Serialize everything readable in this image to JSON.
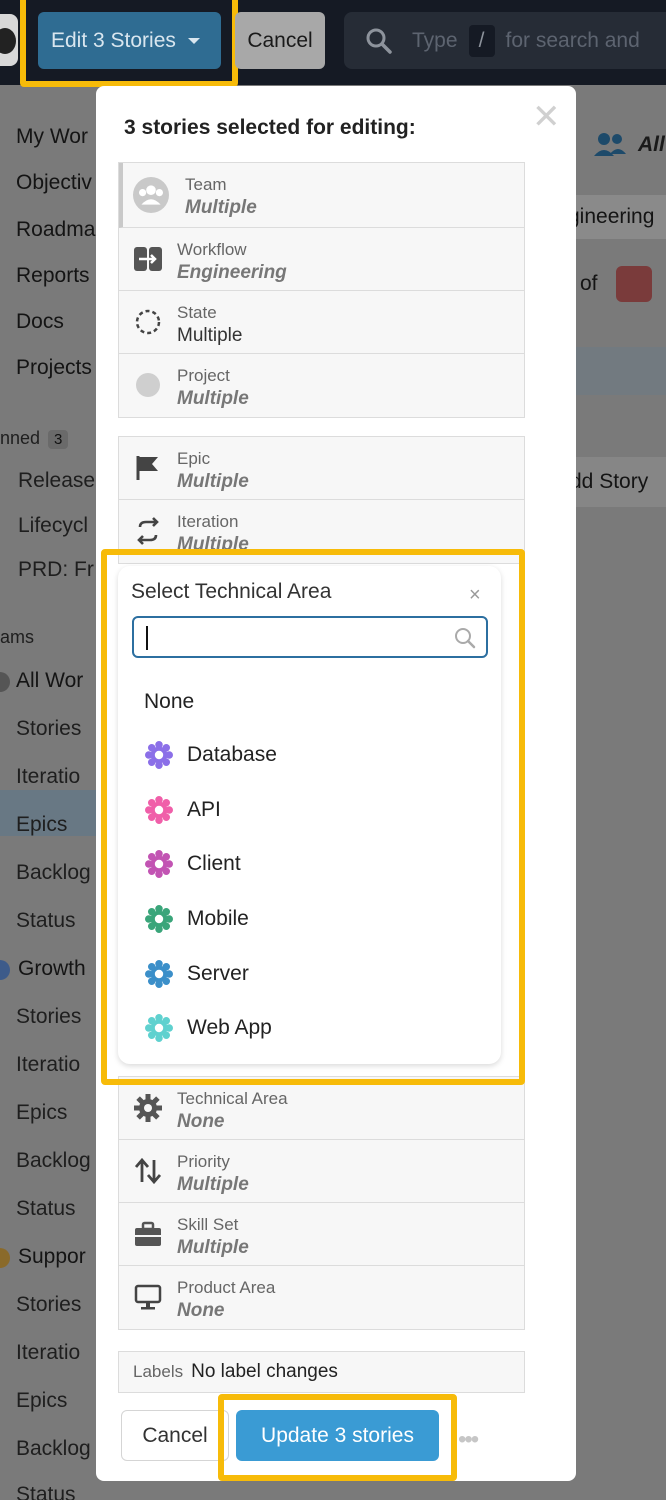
{
  "topbar": {
    "edit_button": "Edit 3 Stories",
    "cancel_button": "Cancel",
    "search_before_key": "Type",
    "search_key": "/",
    "search_after_key": "for search and"
  },
  "sidebar": {
    "nav": [
      "My Wor",
      "Objectiv",
      "Roadma",
      "Reports",
      "Docs",
      "Projects"
    ],
    "pinned_heading": "nned",
    "pinned_count": "3",
    "pinned": [
      "Release",
      "Lifecycl",
      "PRD: Fr"
    ],
    "teams_heading": "ams",
    "team_all": "All Wor",
    "team_all_items": [
      "Stories",
      "Iteratio",
      "Epics",
      "Backlog",
      "Status"
    ],
    "team_growth": "Growth",
    "team_growth_items": [
      "Stories",
      "Iteratio",
      "Epics",
      "Backlog",
      "Status"
    ],
    "team_support": "Suppor",
    "team_support_items": [
      "Stories",
      "Iteratio",
      "Epics",
      "Backlog",
      "Status"
    ]
  },
  "background": {
    "filter_all": "All",
    "workflow_chip": "gineering",
    "of_text": "of",
    "add_story": "dd Story"
  },
  "modal": {
    "title": "3 stories selected for editing:",
    "group1": [
      {
        "label": "Team",
        "value": "Multiple",
        "italic": true
      },
      {
        "label": "Workflow",
        "value": "Engineering",
        "italic": true
      },
      {
        "label": "State",
        "value": "Multiple",
        "italic": false
      },
      {
        "label": "Project",
        "value": "Multiple",
        "italic": true
      }
    ],
    "group2": [
      {
        "label": "Epic",
        "value": "Multiple"
      },
      {
        "label": "Iteration",
        "value": "Multiple"
      }
    ],
    "group3": [
      {
        "label": "Technical Area",
        "value": "None"
      },
      {
        "label": "Priority",
        "value": "Multiple"
      },
      {
        "label": "Skill Set",
        "value": "Multiple"
      },
      {
        "label": "Product Area",
        "value": "None"
      }
    ],
    "labels_label": "Labels",
    "labels_value": "No label changes",
    "cancel_button": "Cancel",
    "update_button": "Update 3 stories"
  },
  "dropdown": {
    "title": "Select Technical Area",
    "close": "×",
    "search_value": "",
    "none_option": "None",
    "options": [
      {
        "label": "Database",
        "color": "#8b6fe8"
      },
      {
        "label": "API",
        "color": "#f05fa9"
      },
      {
        "label": "Client",
        "color": "#c254b3"
      },
      {
        "label": "Mobile",
        "color": "#3aa57a"
      },
      {
        "label": "Server",
        "color": "#3b8fc9"
      },
      {
        "label": "Web App",
        "color": "#5fd1cf"
      }
    ]
  },
  "colors": {
    "highlight": "#f7bb09",
    "edit_button": "#2f6c92",
    "update_button": "#3a9bd4"
  }
}
